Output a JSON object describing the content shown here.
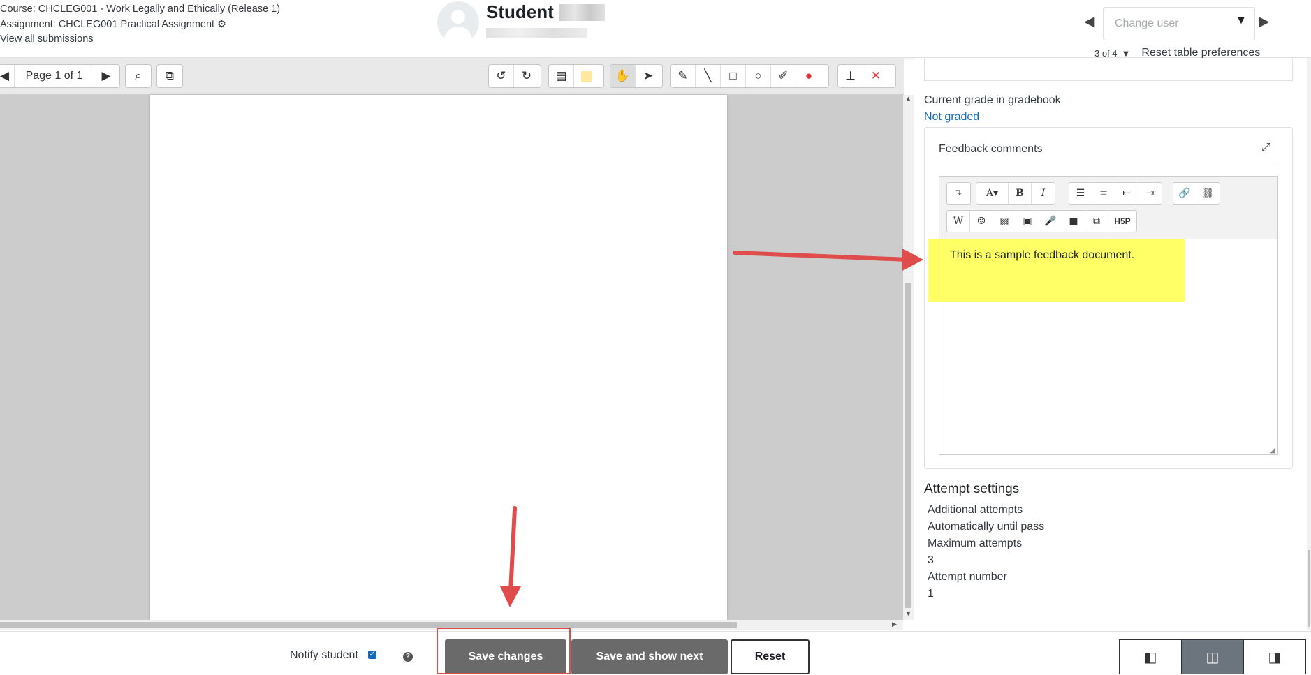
{
  "header": {
    "course": "Course: CHCLEG001 - Work Legally and Ethically (Release 1)",
    "assignment": "Assignment: CHCLEG001 Practical Assignment",
    "view_all": "View all submissions",
    "student_name": "Student",
    "change_user_placeholder": "Change user",
    "count": "3 of 4",
    "reset_prefs": "Reset table preferences"
  },
  "toolbar": {
    "page_label": "Page 1 of 1"
  },
  "grading": {
    "current_grade_label": "Current grade in gradebook",
    "current_grade_value": "Not graded",
    "feedback_title": "Feedback comments",
    "feedback_text": "This is a sample feedback document.",
    "h5p_label": "H5P"
  },
  "attempt_settings": {
    "title": "Attempt settings",
    "items": [
      {
        "label": "Additional attempts",
        "value": "Automatically until pass"
      },
      {
        "label": "Maximum attempts",
        "value": "3"
      },
      {
        "label": "Attempt number",
        "value": "1"
      }
    ]
  },
  "footer": {
    "notify_label": "Notify student",
    "help": "?",
    "save_changes": "Save changes",
    "save_show_next": "Save and show next",
    "reset": "Reset"
  },
  "colors": {
    "annotation_red": "#e04b4b",
    "highlight_yellow": "#ffff66",
    "link_blue": "#0f6cbf"
  }
}
